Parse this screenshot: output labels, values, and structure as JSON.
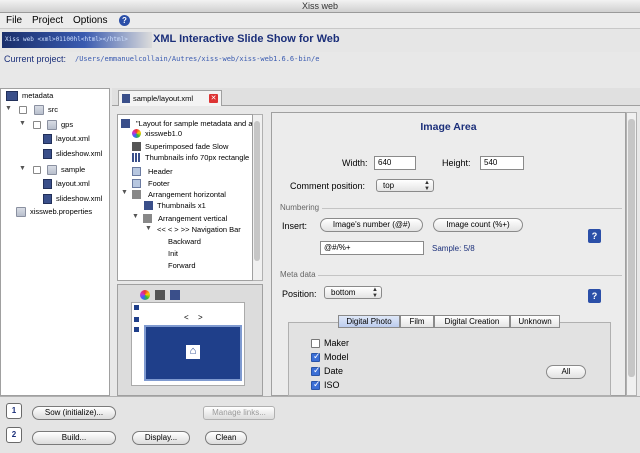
{
  "window": {
    "title": "Xiss web"
  },
  "menu": {
    "items": [
      "File",
      "Project",
      "Options"
    ],
    "help_glyph": "?"
  },
  "banner": {
    "logo_text": "Xiss web  <xml>01100hl<html></html>",
    "app_title": "XML Interactive Slide Show for Web"
  },
  "project": {
    "label": "Current project:",
    "path": "/Users/emmanuelcollain/Autres/xiss-web/xiss-web1.6.6-bin/e"
  },
  "left_tree": {
    "root": "metadata",
    "items": [
      {
        "label": "src"
      },
      {
        "label": "gps"
      },
      {
        "label": "layout.xml"
      },
      {
        "label": "slideshow.xml"
      },
      {
        "label": "sample"
      },
      {
        "label": "layout.xml"
      },
      {
        "label": "slideshow.xml"
      },
      {
        "label": "xissweb.properties"
      }
    ]
  },
  "editor_tab": {
    "label": "sample/layout.xml",
    "close_glyph": "✕"
  },
  "outline": {
    "items": [
      "\"Layout for sample metadata and all",
      "xissweb1.0",
      "Superimposed fade Slow",
      "Thumbnails info 70px rectangle",
      "Header",
      "Footer",
      "Arrangement horizontal",
      "Thumbnails x1",
      "Arrangement vertical",
      "<< <  > >> Navigation Bar",
      "Backward",
      "Init",
      "Forward"
    ]
  },
  "preview": {
    "nav_prev": "<",
    "nav_next": ">",
    "home_glyph": "⌂"
  },
  "image_area": {
    "title": "Image Area",
    "width_label": "Width:",
    "width_value": "640",
    "height_label": "Height:",
    "height_value": "540",
    "comment_label": "Comment position:",
    "comment_value": "top"
  },
  "numbering": {
    "title": "Numbering",
    "insert_label": "Insert:",
    "btn_image_number": "Image's number (@#)",
    "btn_image_count": "Image count (%+)",
    "pattern_value": "@#/%+",
    "sample_text": "Sample: 5/8"
  },
  "meta": {
    "title": "Meta data",
    "position_label": "Position:",
    "position_value": "bottom",
    "tabs": [
      "Digital Photo",
      "Film",
      "Digital Creation",
      "Unknown"
    ],
    "active_tab": "Digital Photo",
    "fields": [
      {
        "label": "Maker",
        "checked": false
      },
      {
        "label": "Model",
        "checked": true
      },
      {
        "label": "Date",
        "checked": true
      },
      {
        "label": "ISO",
        "checked": true
      }
    ],
    "all_button": "All"
  },
  "bottom": {
    "step1": "1",
    "step2": "2",
    "sow_button": "Sow (initialize)...",
    "manage_links": "Manage links...",
    "build_button": "Build...",
    "display_button": "Display...",
    "clean_button": "Clean"
  },
  "colors": {
    "accent": "#1b2f7a",
    "help_blue": "#2b4fa8",
    "check_blue": "#3b6fd6"
  }
}
